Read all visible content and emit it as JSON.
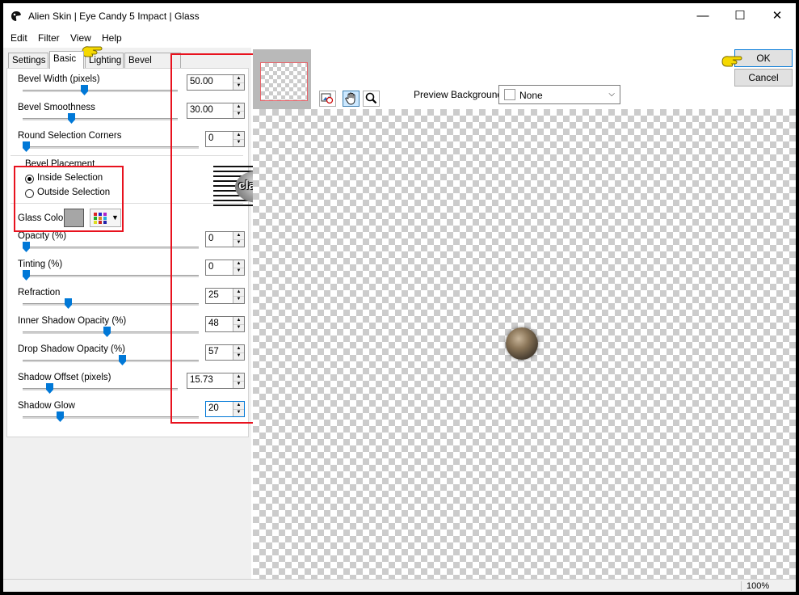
{
  "window": {
    "title": "Alien Skin | Eye Candy 5 Impact | Glass",
    "minimize_glyph": "—",
    "maximize_glyph": "☐",
    "close_glyph": "✕"
  },
  "menu": [
    "Edit",
    "Filter",
    "View",
    "Help"
  ],
  "tabs": [
    "Settings",
    "Basic",
    "Lighting",
    "Bevel Profile"
  ],
  "active_tab": "Basic",
  "params": {
    "bevel_width": {
      "label": "Bevel Width (pixels)",
      "value": "50.00"
    },
    "bevel_smoothness": {
      "label": "Bevel Smoothness",
      "value": "30.00"
    },
    "round_corners": {
      "label": "Round Selection Corners",
      "value": "0"
    },
    "opacity": {
      "label": "Opacity (%)",
      "value": "0"
    },
    "tinting": {
      "label": "Tinting (%)",
      "value": "0"
    },
    "refraction": {
      "label": "Refraction",
      "value": "25"
    },
    "inner_shadow": {
      "label": "Inner Shadow Opacity (%)",
      "value": "48"
    },
    "drop_shadow": {
      "label": "Drop Shadow Opacity (%)",
      "value": "57"
    },
    "shadow_offset": {
      "label": "Shadow Offset (pixels)",
      "value": "15.73"
    },
    "shadow_glow": {
      "label": "Shadow Glow",
      "value": "20"
    }
  },
  "bevel_placement": {
    "label": "Bevel Placement",
    "inside": "Inside Selection",
    "outside": "Outside Selection",
    "selected": "inside"
  },
  "glass_color": {
    "label": "Glass Color",
    "swatch": "#a6a6a6"
  },
  "preview_background": {
    "label": "Preview Background:",
    "value": "None"
  },
  "buttons": {
    "ok": "OK",
    "cancel": "Cancel"
  },
  "watermark": {
    "text": "claudia"
  },
  "status": {
    "zoom": "100%"
  },
  "colors": {
    "accent": "#0078d7",
    "highlight_box": "#e8121e",
    "hand": "#f5d800"
  },
  "icons": {
    "app": "alien-skin-icon",
    "tools": [
      "preview-compare-icon",
      "hand-pan-icon",
      "zoom-icon"
    ],
    "pointer": "pointing-hand-icon"
  }
}
